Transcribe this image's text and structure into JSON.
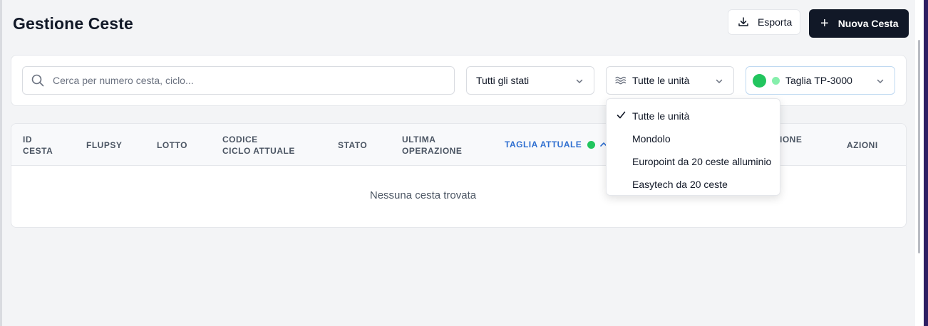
{
  "page": {
    "title": "Gestione Ceste"
  },
  "toolbar": {
    "export_label": "Esporta",
    "export_icon": "download-icon",
    "new_label": "Nuova Cesta",
    "new_icon": "plus-icon"
  },
  "filters": {
    "search": {
      "placeholder": "Cerca per numero cesta, ciclo...",
      "value": "",
      "icon": "search-icon"
    },
    "status": {
      "selected": "Tutti gli stati"
    },
    "unit": {
      "selected": "Tutte le unità",
      "icon": "waves-icon"
    },
    "size": {
      "selected": "Taglia TP-3000",
      "dot_color": "#22c55e",
      "dot_color_light": "#86efac"
    }
  },
  "table": {
    "columns": [
      {
        "line1": "ID",
        "line2": "CESTA"
      },
      {
        "line1": "FLUPSY",
        "line2": ""
      },
      {
        "line1": "LOTTO",
        "line2": ""
      },
      {
        "line1": "CODICE",
        "line2": "CICLO ATTUALE"
      },
      {
        "line1": "STATO",
        "line2": ""
      },
      {
        "line1": "ULTIMA",
        "line2": "OPERAZIONE"
      },
      {
        "line1": "TAGLIA ATTUALE",
        "line2": ""
      },
      {
        "line1": "",
        "line2": "IONE"
      },
      {
        "line1": "AZIONI",
        "line2": ""
      }
    ],
    "active_sort_column": "TAGLIA ATTUALE",
    "sort_direction": "ascending",
    "empty_message": "Nessuna cesta trovata"
  },
  "unit_dropdown": {
    "items": [
      {
        "label": "Tutte le unità",
        "checked": true
      },
      {
        "label": "Mondolo",
        "checked": false
      },
      {
        "label": "Europoint da 20 ceste alluminio",
        "checked": false
      },
      {
        "label": "Easytech da 20 ceste",
        "checked": false
      }
    ]
  },
  "colors": {
    "primary": "#111827",
    "accent": "#2f6fd0",
    "status_green": "#22c55e"
  }
}
